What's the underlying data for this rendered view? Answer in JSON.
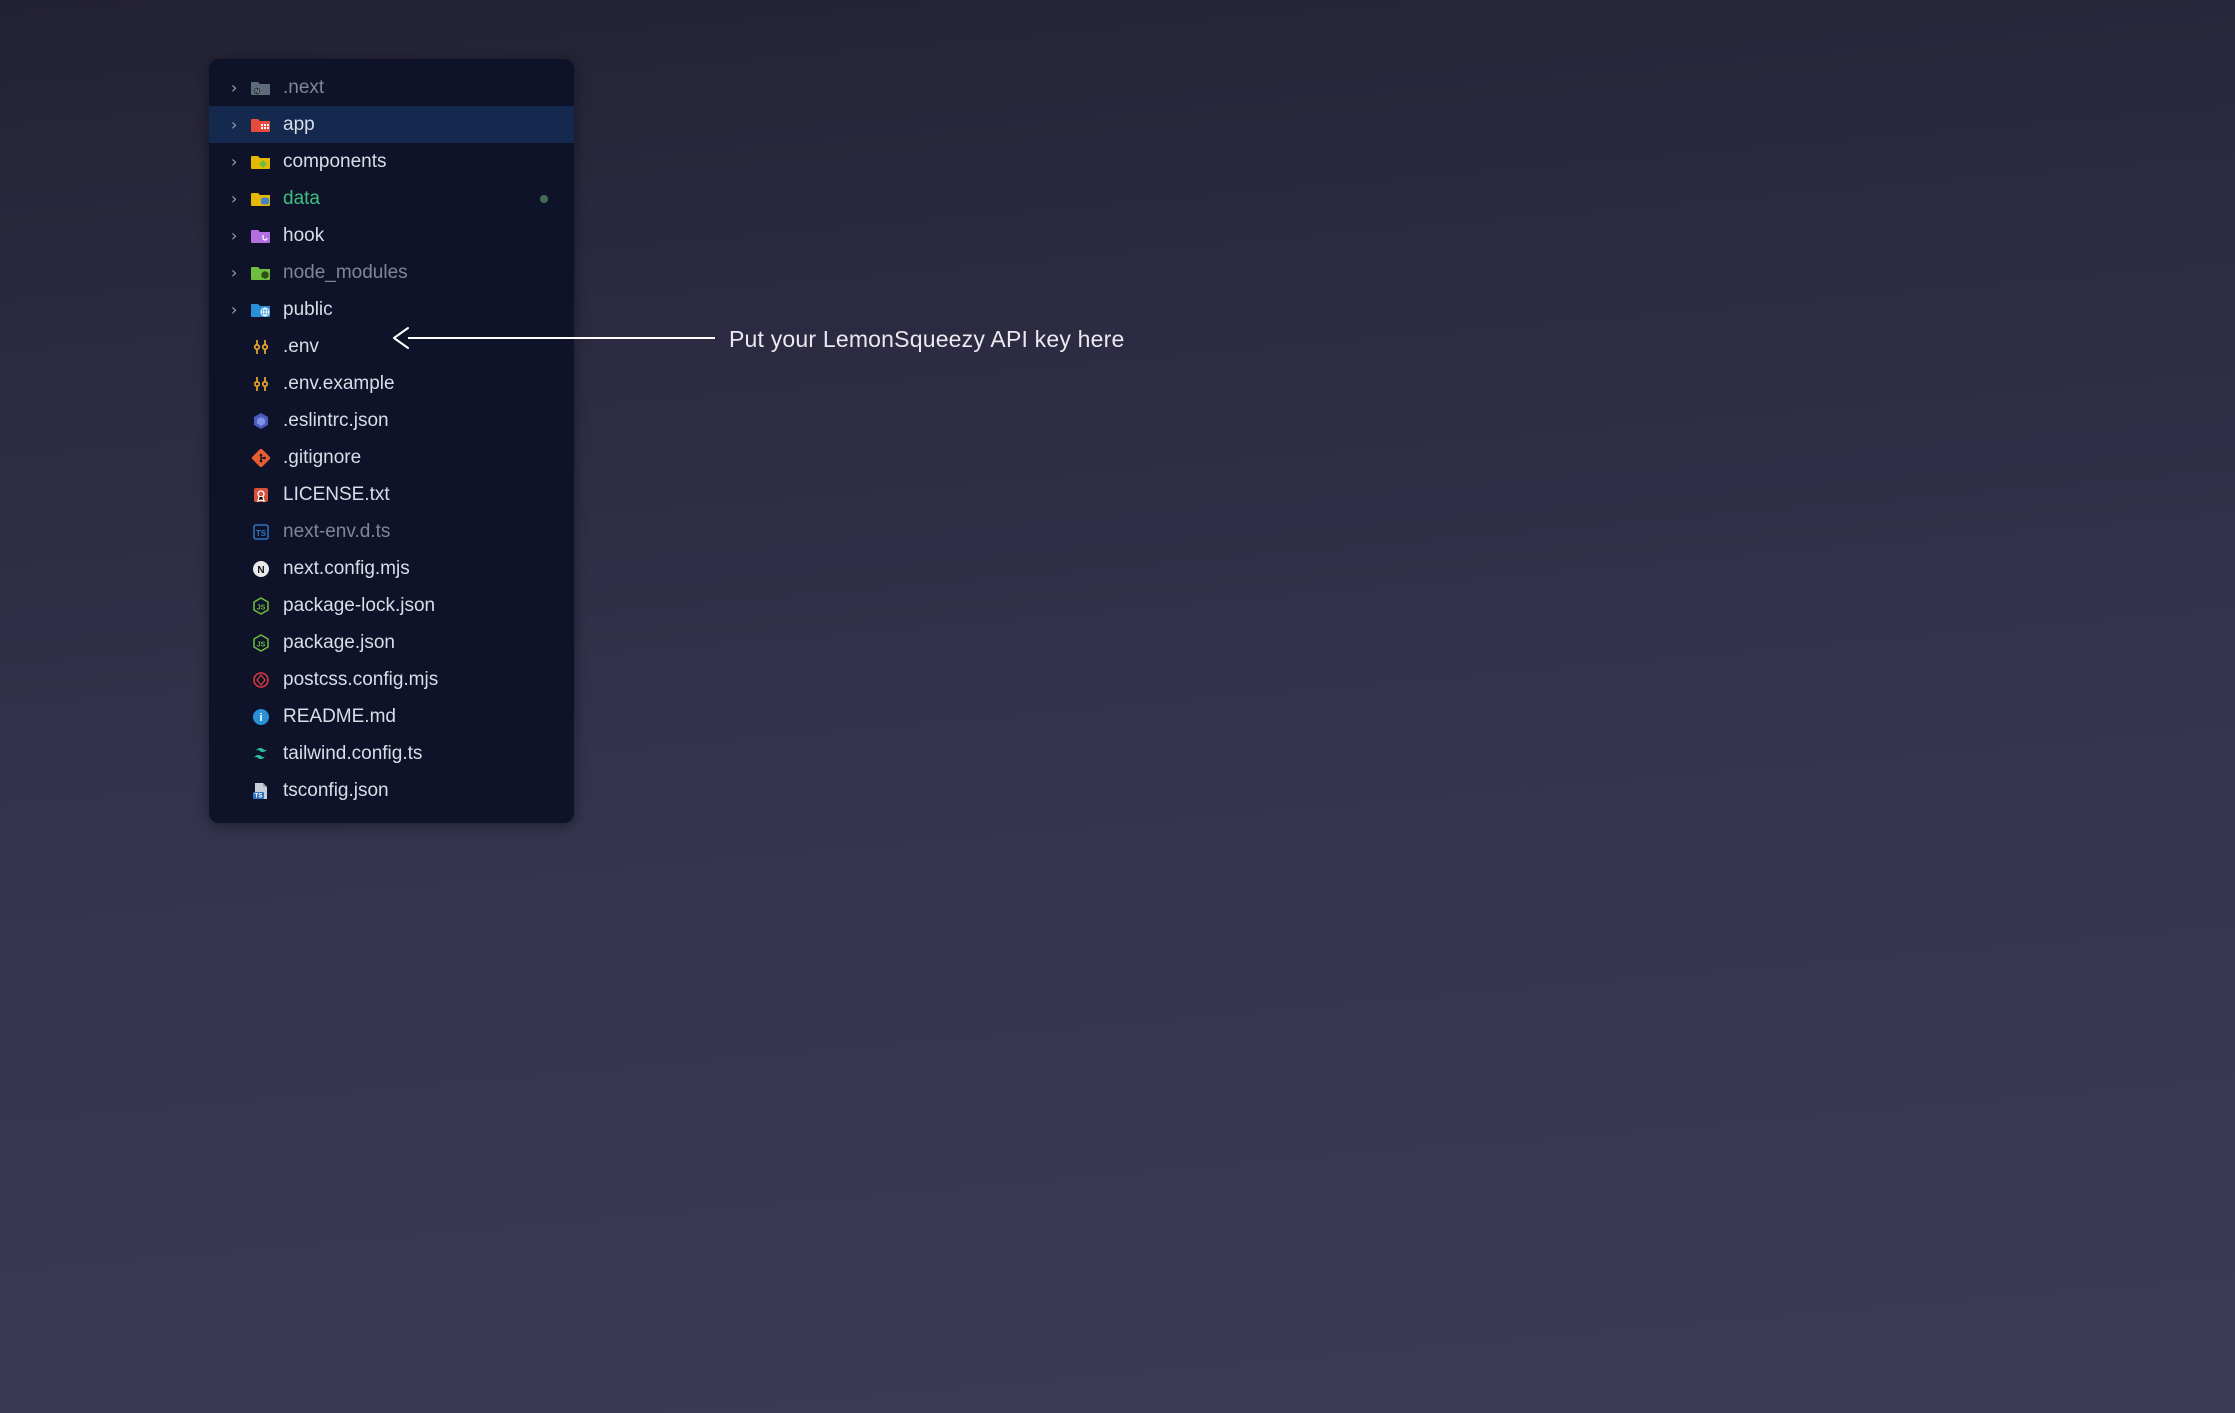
{
  "annotation": "Put your LemonSqueezy API key here",
  "tree": [
    {
      "name": ".next",
      "icon": "folder-next",
      "chevron": true,
      "labelClass": "dim"
    },
    {
      "name": "app",
      "icon": "folder-app",
      "chevron": true,
      "labelClass": "",
      "selected": true
    },
    {
      "name": "components",
      "icon": "folder-comp",
      "chevron": true,
      "labelClass": ""
    },
    {
      "name": "data",
      "icon": "folder-data",
      "chevron": true,
      "labelClass": "green",
      "greenDot": true
    },
    {
      "name": "hook",
      "icon": "folder-hook",
      "chevron": true,
      "labelClass": ""
    },
    {
      "name": "node_modules",
      "icon": "folder-node",
      "chevron": true,
      "labelClass": "dim"
    },
    {
      "name": "public",
      "icon": "folder-public",
      "chevron": true,
      "labelClass": ""
    },
    {
      "name": ".env",
      "icon": "env",
      "chevron": false,
      "labelClass": ""
    },
    {
      "name": ".env.example",
      "icon": "env",
      "chevron": false,
      "labelClass": ""
    },
    {
      "name": ".eslintrc.json",
      "icon": "eslint",
      "chevron": false,
      "labelClass": ""
    },
    {
      "name": ".gitignore",
      "icon": "git",
      "chevron": false,
      "labelClass": ""
    },
    {
      "name": "LICENSE.txt",
      "icon": "license",
      "chevron": false,
      "labelClass": ""
    },
    {
      "name": "next-env.d.ts",
      "icon": "dts",
      "chevron": false,
      "labelClass": "dim"
    },
    {
      "name": "next.config.mjs",
      "icon": "nextjs",
      "chevron": false,
      "labelClass": ""
    },
    {
      "name": "package-lock.json",
      "icon": "nodejs",
      "chevron": false,
      "labelClass": ""
    },
    {
      "name": "package.json",
      "icon": "nodejs",
      "chevron": false,
      "labelClass": ""
    },
    {
      "name": "postcss.config.mjs",
      "icon": "postcss",
      "chevron": false,
      "labelClass": ""
    },
    {
      "name": "README.md",
      "icon": "readme",
      "chevron": false,
      "labelClass": ""
    },
    {
      "name": "tailwind.config.ts",
      "icon": "tailwind",
      "chevron": false,
      "labelClass": ""
    },
    {
      "name": "tsconfig.json",
      "icon": "tsconfig",
      "chevron": false,
      "labelClass": ""
    }
  ]
}
